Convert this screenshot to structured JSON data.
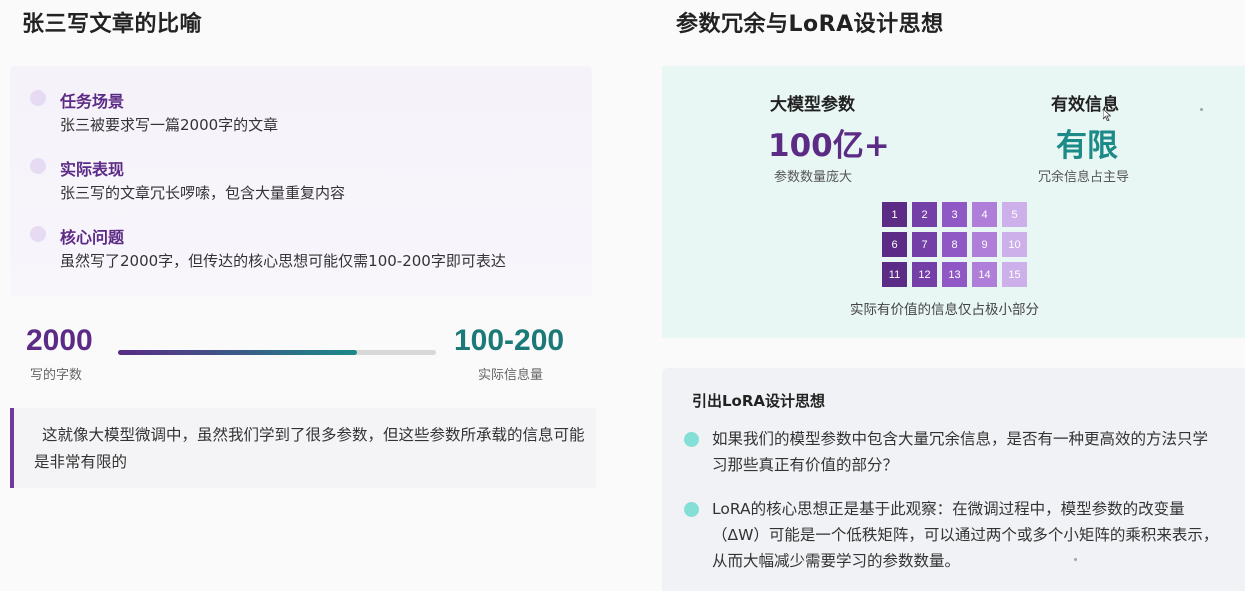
{
  "left": {
    "title": "张三写文章的比喻",
    "items": [
      {
        "head": "任务场景",
        "body": "张三被要求写一篇2000字的文章"
      },
      {
        "head": "实际表现",
        "body": "张三写的文章冗长啰嗦，包含大量重复内容"
      },
      {
        "head": "核心问题",
        "body": "虽然写了2000字，但传达的核心思想可能仅需100-200字即可表达"
      }
    ],
    "compare": {
      "left_value": "2000",
      "left_label": "写的字数",
      "right_value": "100-200",
      "right_label": "实际信息量",
      "progress": 0.75
    },
    "quote": "这就像大模型微调中，虽然我们学到了很多参数，但这些参数所承载的信息可能是非常有限的"
  },
  "right": {
    "title": "参数冗余与LoRA设计思想",
    "stats": [
      {
        "title": "大模型参数",
        "value": "100亿+",
        "sub": "参数数量庞大",
        "color": "#5b2b86"
      },
      {
        "title": "有效信息",
        "value": "有限",
        "sub": "冗余信息占主导",
        "color": "#1b8a88"
      }
    ],
    "grid": {
      "cells": [
        "1",
        "2",
        "3",
        "4",
        "5",
        "6",
        "7",
        "8",
        "9",
        "10",
        "11",
        "12",
        "13",
        "14",
        "15"
      ],
      "column_colors": [
        "#5b2b86",
        "#7440a8",
        "#9058c4",
        "#ae7ed8",
        "#cdb0ea"
      ],
      "caption": "实际有价值的信息仅占极小部分"
    },
    "lora": {
      "title": "引出LoRA设计思想",
      "paragraphs": [
        "如果我们的模型参数中包含大量冗余信息，是否有一种更高效的方法只学习那些真正有价值的部分？",
        "LoRA的核心思想正是基于此观察：在微调过程中，模型参数的改变量（ΔW）可能是一个低秩矩阵，可以通过两个或多个小矩阵的乘积来表示，从而大幅减少需要学习的参数数量。"
      ],
      "dot_color": "#84dfd7"
    }
  }
}
